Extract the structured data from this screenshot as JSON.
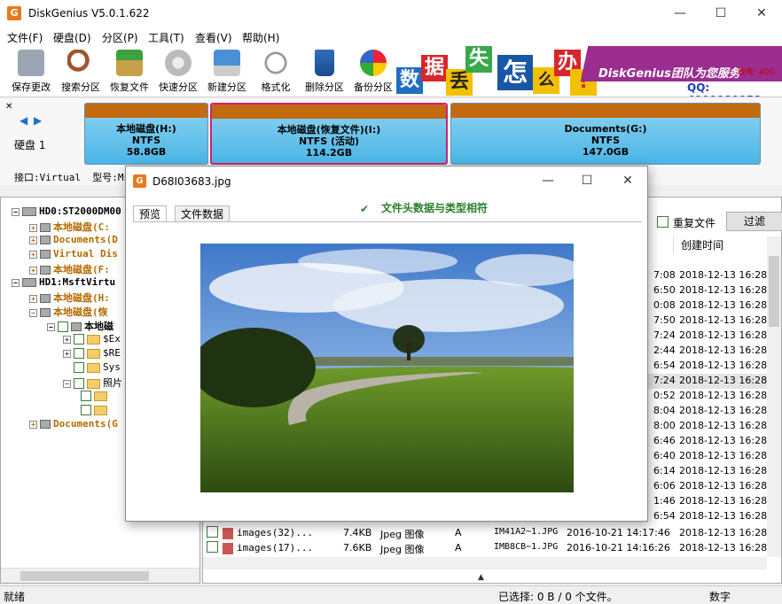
{
  "window": {
    "title": "DiskGenius V5.0.1.622",
    "icon_letter": "G"
  },
  "menu": [
    "文件(F)",
    "硬盘(D)",
    "分区(P)",
    "工具(T)",
    "查看(V)",
    "帮助(H)"
  ],
  "toolbar": [
    "保存更改",
    "搜索分区",
    "恢复文件",
    "快速分区",
    "新建分区",
    "格式化",
    "删除分区",
    "备份分区"
  ],
  "banner": {
    "chars": [
      "数",
      "据",
      "丢",
      "失",
      "怎",
      "么",
      "办",
      "!"
    ],
    "brand": "DiskGenius团队为您服务",
    "sub": "致电: 400-",
    "qq": "QQ: 4000089958"
  },
  "disk_map": {
    "disk_label": "硬盘 1",
    "interface": "接口:Virtual  型号:Ms",
    "partitions": [
      {
        "name": "本地磁盘(H:)",
        "fs": "NTFS",
        "size": "58.8GB"
      },
      {
        "name": "本地磁盘(恢复文件)(I:)",
        "fs": "NTFS (活动)",
        "size": "114.2GB"
      },
      {
        "name": "Documents(G:)",
        "fs": "NTFS",
        "size": "147.0GB"
      }
    ]
  },
  "tree": [
    "HD0:ST2000DM00",
    "本地磁盘(C:",
    "Documents(D",
    "Virtual Dis",
    "本地磁盘(F:",
    "HD1:MsftVirtu",
    "本地磁盘(H:",
    "本地磁盘(恢",
    "本地磁",
    "$Ex",
    "$RE",
    "Sys",
    "照片",
    "",
    "",
    "Documents(G"
  ],
  "filter": {
    "dup_label": "重复文件",
    "filter_button": "过滤"
  },
  "list_header": {
    "created": "创建时间"
  },
  "list_rows": [
    {
      "mod": "7:08",
      "created": "2018-12-13 16:28"
    },
    {
      "mod": "6:50",
      "created": "2018-12-13 16:28"
    },
    {
      "mod": "0:08",
      "created": "2018-12-13 16:28"
    },
    {
      "mod": "7:50",
      "created": "2018-12-13 16:28"
    },
    {
      "mod": "7:24",
      "created": "2018-12-13 16:28"
    },
    {
      "mod": "2:44",
      "created": "2018-12-13 16:28"
    },
    {
      "mod": "6:54",
      "created": "2018-12-13 16:28"
    },
    {
      "mod": "7:24",
      "created": "2018-12-13 16:28"
    },
    {
      "mod": "0:52",
      "created": "2018-12-13 16:28"
    },
    {
      "mod": "8:04",
      "created": "2018-12-13 16:28"
    },
    {
      "mod": "8:00",
      "created": "2018-12-13 16:28"
    },
    {
      "mod": "6:46",
      "created": "2018-12-13 16:28"
    },
    {
      "mod": "6:40",
      "created": "2018-12-13 16:28"
    },
    {
      "mod": "6:14",
      "created": "2018-12-13 16:28"
    },
    {
      "mod": "6:06",
      "created": "2018-12-13 16:28"
    },
    {
      "mod": "1:46",
      "created": "2018-12-13 16:28"
    },
    {
      "mod": "6:54",
      "created": "2018-12-13 16:28"
    }
  ],
  "list_files": [
    {
      "name": "images(32)...",
      "size": "7.4KB",
      "type": "Jpeg 图像",
      "attr": "A",
      "short": "IM41A2~1.JPG",
      "mod": "2016-10-21 14:17:46",
      "created": "2018-12-13 16:28"
    },
    {
      "name": "images(17)...",
      "size": "7.6KB",
      "type": "Jpeg 图像",
      "attr": "A",
      "short": "IMB8CB~1.JPG",
      "mod": "2016-10-21 14:16:26",
      "created": "2018-12-13 16:28"
    }
  ],
  "dialog": {
    "title": "D68I03683.jpg",
    "tabs": [
      "预览",
      "文件数据"
    ],
    "match_text": "文件头数据与类型相符"
  },
  "status": {
    "left": "就绪",
    "selected": "已选择: 0 B / 0 个文件。",
    "mode": "数字"
  }
}
